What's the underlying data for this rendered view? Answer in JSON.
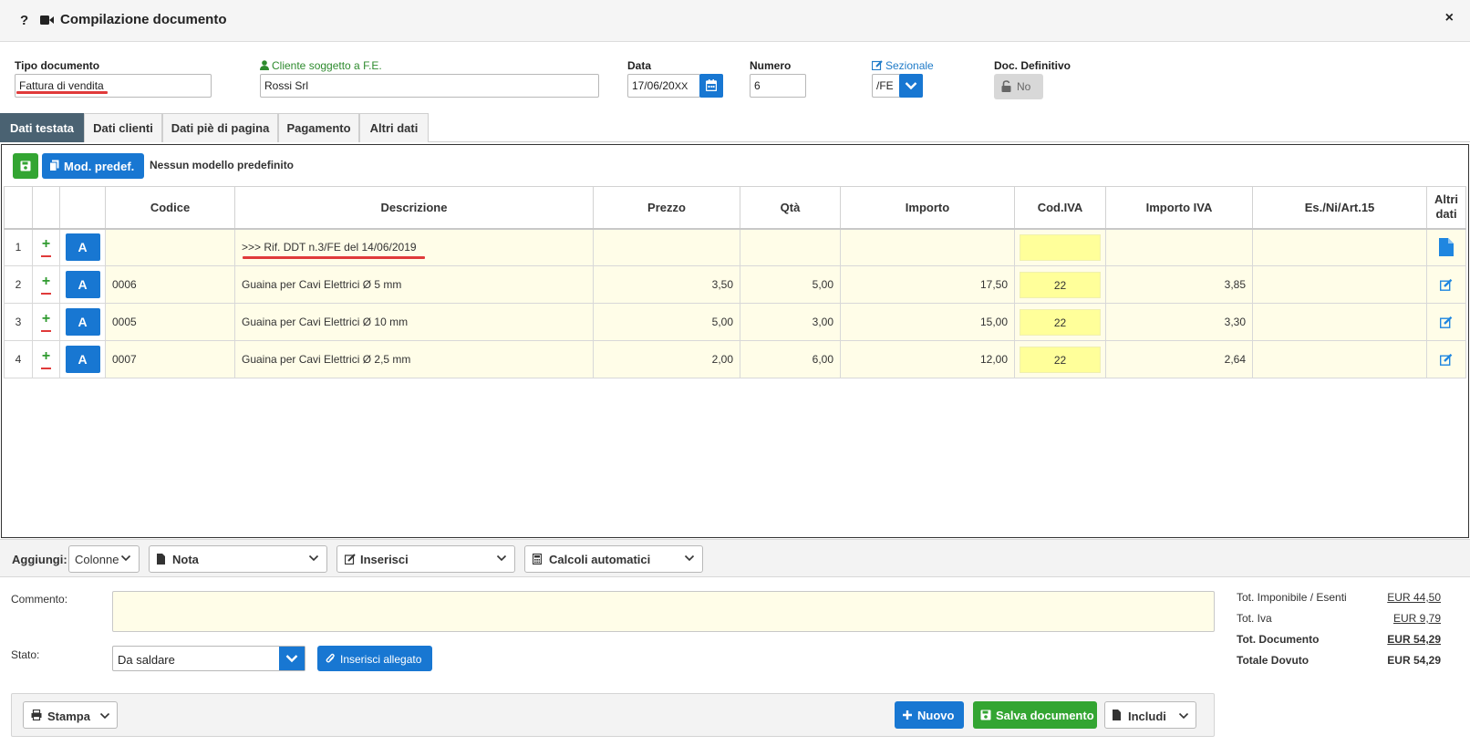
{
  "header": {
    "help": "?",
    "title": "Compilazione documento",
    "close": "×"
  },
  "fields": {
    "tipo_label": "Tipo documento",
    "tipo_value": "Fattura di vendita",
    "cliente_label": "Cliente soggetto a F.E.",
    "cliente_value": "Rossi Srl",
    "data_label": "Data",
    "data_value": "17/06/20",
    "data_clear": "XX",
    "numero_label": "Numero",
    "numero_value": "6",
    "sezionale_label": "Sezionale",
    "sezionale_value": "/FE",
    "definitivo_label": "Doc. Definitivo",
    "definitivo_value": "No"
  },
  "tabs": [
    {
      "label": "Dati testata",
      "active": true
    },
    {
      "label": "Dati clienti",
      "active": false
    },
    {
      "label": "Dati piè di pagina",
      "active": false
    },
    {
      "label": "Pagamento",
      "active": false
    },
    {
      "label": "Altri dati",
      "active": false
    }
  ],
  "toolbar": {
    "model_button": "Mod. predef.",
    "model_status": "Nessun modello predefinito"
  },
  "table": {
    "headers": {
      "codice": "Codice",
      "descrizione": "Descrizione",
      "prezzo": "Prezzo",
      "qta": "Qtà",
      "importo": "Importo",
      "cod_iva": "Cod.IVA",
      "importo_iva": "Importo IVA",
      "es": "Es./Ni/Art.15",
      "altri_1": "Altri",
      "altri_2": "dati"
    },
    "row_button": "A",
    "rows": [
      {
        "idx": "1",
        "codice": "",
        "descrizione": ">>> Rif. DDT n.3/FE del 14/06/2019",
        "prezzo": "",
        "qta": "",
        "importo": "",
        "cod_iva": "",
        "importo_iva": "",
        "es": "",
        "icon": "file-icon"
      },
      {
        "idx": "2",
        "codice": "0006",
        "descrizione": "Guaina per Cavi Elettrici Ø 5 mm",
        "prezzo": "3,50",
        "qta": "5,00",
        "importo": "17,50",
        "cod_iva": "22",
        "importo_iva": "3,85",
        "es": "",
        "icon": "edit-icon"
      },
      {
        "idx": "3",
        "codice": "0005",
        "descrizione": "Guaina per Cavi Elettrici Ø 10 mm",
        "prezzo": "5,00",
        "qta": "3,00",
        "importo": "15,00",
        "cod_iva": "22",
        "importo_iva": "3,30",
        "es": "",
        "icon": "edit-icon"
      },
      {
        "idx": "4",
        "codice": "0007",
        "descrizione": "Guaina per Cavi Elettrici Ø 2,5 mm",
        "prezzo": "2,00",
        "qta": "6,00",
        "importo": "12,00",
        "cod_iva": "22",
        "importo_iva": "2,64",
        "es": "",
        "icon": "edit-icon"
      }
    ]
  },
  "add_bar": {
    "label": "Aggiungi:",
    "colonne": "Colonne",
    "nota": "Nota",
    "inserisci": "Inserisci",
    "calcoli": "Calcoli automatici"
  },
  "comment": {
    "label": "Commento:",
    "value": ""
  },
  "stato": {
    "label": "Stato:",
    "value": "Da saldare",
    "attach_button": "Inserisci allegato"
  },
  "totals": [
    {
      "label": "Tot. Imponibile / Esenti",
      "value": "EUR 44,50"
    },
    {
      "label": "Tot. Iva",
      "value": "EUR 9,79"
    },
    {
      "label": "Tot. Documento",
      "value": "EUR 54,29"
    },
    {
      "label": "Totale Dovuto",
      "value": "EUR 54,29"
    }
  ],
  "footer": {
    "stampa": "Stampa",
    "nuovo": "Nuovo",
    "salva": "Salva documento",
    "includi": "Includi"
  },
  "colors": {
    "primary": "#1877d2",
    "success": "#33a532",
    "tab_active": "#4a6272",
    "row_bg": "#fffde8",
    "iva_bg": "#ffff9a",
    "underline_red": "#e03a3a"
  }
}
